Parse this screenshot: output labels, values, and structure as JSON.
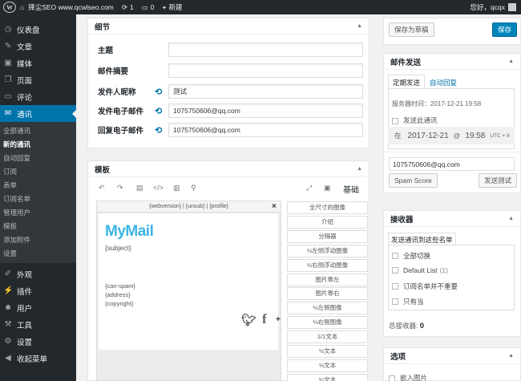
{
  "adminbar": {
    "site_name": "择尘SEO www.qcwlseo.com",
    "updates_count": "1",
    "comments_count": "0",
    "new_label": "新建",
    "greeting": "您好，qcqx"
  },
  "sidebar": {
    "items_top": [
      {
        "label": "仪表盘",
        "icon": "dashboard-icon",
        "glyph": "◷"
      },
      {
        "label": "文章",
        "icon": "pin-icon",
        "glyph": "✎"
      },
      {
        "label": "媒体",
        "icon": "media-icon",
        "glyph": "▣"
      },
      {
        "label": "页面",
        "icon": "page-icon",
        "glyph": "❐"
      },
      {
        "label": "评论",
        "icon": "comment-icon",
        "glyph": "▭"
      },
      {
        "label": "通讯",
        "icon": "mail-icon",
        "glyph": "✉"
      }
    ],
    "submenu": [
      "全部通讯",
      "新的通讯",
      "自动回复",
      "订阅",
      "表单",
      "订阅名单",
      "管理用户",
      "模板",
      "添加附件",
      "设置"
    ],
    "items_bottom": [
      {
        "label": "外观",
        "icon": "appearance-icon",
        "glyph": "✐"
      },
      {
        "label": "插件",
        "icon": "plugin-icon",
        "glyph": "⚡"
      },
      {
        "label": "用户",
        "icon": "user-icon",
        "glyph": "☻"
      },
      {
        "label": "工具",
        "icon": "tools-icon",
        "glyph": "⚒"
      },
      {
        "label": "设置",
        "icon": "settings-icon",
        "glyph": "⚙"
      },
      {
        "label": "收起菜单",
        "icon": "collapse-icon",
        "glyph": "◀"
      }
    ]
  },
  "details": {
    "title": "细节",
    "fields": [
      {
        "label": "主题",
        "value": "",
        "sync": false
      },
      {
        "label": "邮件摘要",
        "value": "",
        "sync": false
      },
      {
        "label": "发件人昵称",
        "value": "测试",
        "sync": true
      },
      {
        "label": "发件电子邮件",
        "value": "1075750606@qq.com",
        "sync": true
      },
      {
        "label": "回复电子邮件",
        "value": "1075750606@qq.com",
        "sync": true
      }
    ]
  },
  "template": {
    "title": "模板",
    "mode_label": "基础",
    "header_links": "{webversion} | {unsub} | {profile}",
    "logo": "MyMail",
    "subject": "{subject}",
    "footer_lines": [
      "{can-spam}",
      "{address}",
      "{copyright}"
    ],
    "modules": [
      "全尺寸的图像",
      "介绍",
      "分隔器",
      "½左侧浮动图像",
      "½右侧浮动图像",
      "图片靠左",
      "图片靠右",
      "⅓左侧图像",
      "⅓右侧图像",
      "1/1文本",
      "½文本",
      "⅓文本",
      "¼文本"
    ]
  },
  "publish": {
    "save_draft": "保存为草稿",
    "save": "保存"
  },
  "delivery": {
    "title": "邮件发送",
    "tabs": [
      "定期发送",
      "自动回复"
    ],
    "server_time": "服务器时间：2017-12-21 19:58",
    "send_now_label": "发送此通讯",
    "date_prefix": "在",
    "date": "2017-12-21",
    "at": "@",
    "time": "19:58",
    "timezone": "UTC + 8",
    "test_email": "1075750606@qq.com",
    "spam_score": "Spam Score",
    "send_test": "发送测试"
  },
  "receivers": {
    "title": "接收器",
    "tab": "发送通讯到这些名单",
    "lists": [
      {
        "label": "全部切换",
        "count": ""
      },
      {
        "label": "Default List",
        "count": "(1)"
      },
      {
        "label": "订阅名单并不重要",
        "count": ""
      },
      {
        "label": "只有当",
        "count": ""
      }
    ],
    "total_label": "总接收器:",
    "total": "0"
  },
  "options": {
    "title": "选项",
    "embed_images": "嵌入图片"
  }
}
